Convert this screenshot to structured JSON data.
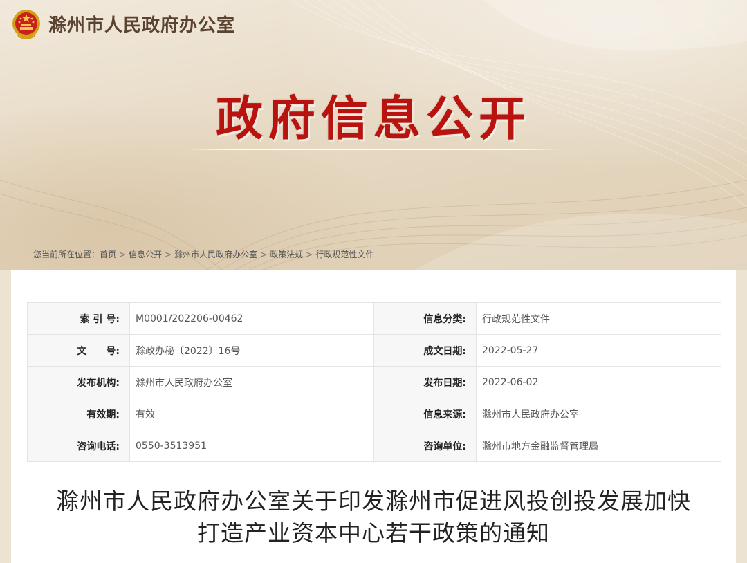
{
  "header": {
    "site_title": "滁州市人民政府办公室",
    "hero_title": "政府信息公开"
  },
  "breadcrumb": {
    "prefix": "您当前所在位置：",
    "items": [
      "首页",
      "信息公开",
      "滁州市人民政府办公室",
      "政策法规",
      "行政规范性文件"
    ],
    "separator": ">"
  },
  "meta_table": {
    "rows": [
      {
        "k1": "索 引 号:",
        "v1": "M0001/202206-00462",
        "k2": "信息分类:",
        "v2": "行政规范性文件"
      },
      {
        "k1": "文　　号:",
        "v1": "滁政办秘〔2022〕16号",
        "k2": "成文日期:",
        "v2": "2022-05-27"
      },
      {
        "k1": "发布机构:",
        "v1": "滁州市人民政府办公室",
        "k2": "发布日期:",
        "v2": "2022-06-02"
      },
      {
        "k1": "有效期:",
        "v1": "有效",
        "k2": "信息来源:",
        "v2": "滁州市人民政府办公室"
      },
      {
        "k1": "咨询电话:",
        "v1": "0550-3513951",
        "k2": "咨询单位:",
        "v2": "滁州市地方金融监督管理局"
      }
    ]
  },
  "document": {
    "title_line1": "滁州市人民政府办公室关于印发滁州市促进风投创投发展加快",
    "title_line2": "打造产业资本中心若干政策的通知"
  },
  "colors": {
    "hero_red": "#b8130f",
    "site_title_brown": "#5b4331",
    "banner_bg": "#e7dac4",
    "table_key_bg": "#f7f7f7"
  },
  "icons": {
    "emblem": "national-emblem-icon"
  }
}
